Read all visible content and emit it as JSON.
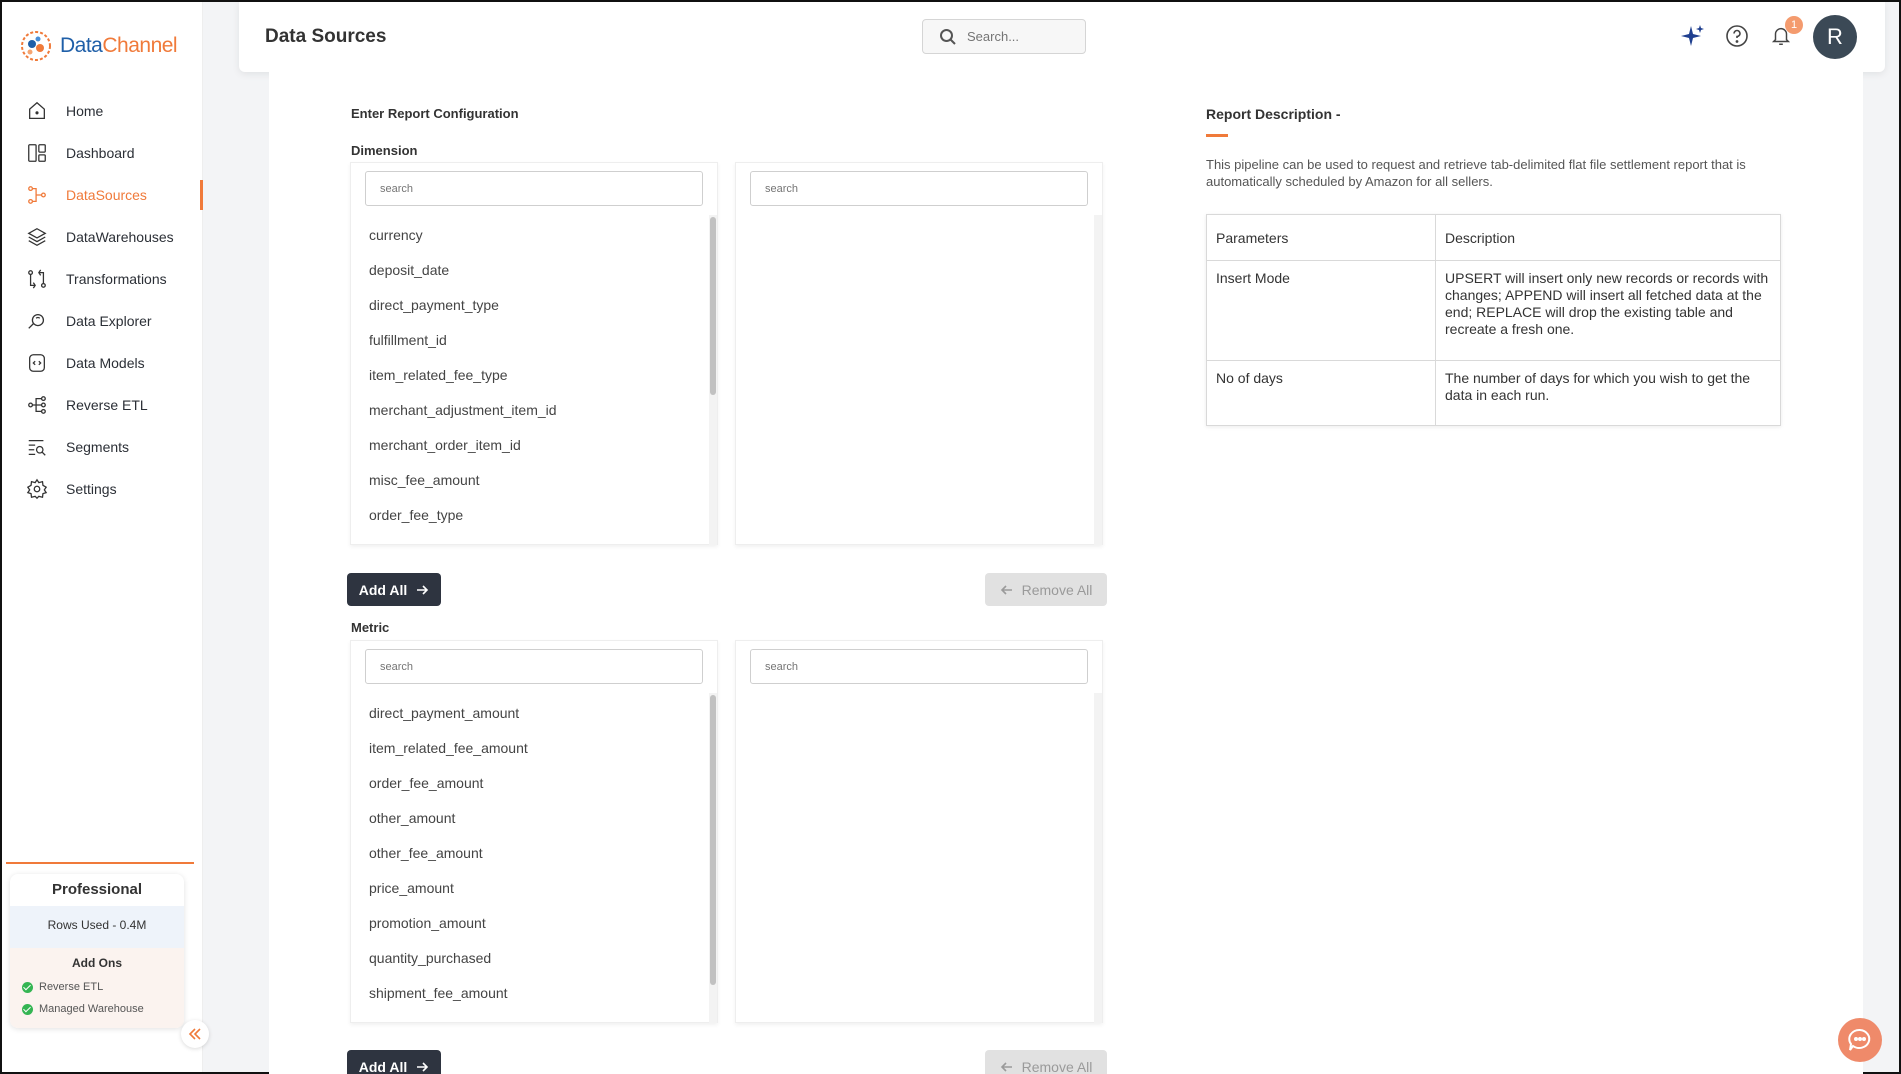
{
  "app": {
    "logo_primary": "Data",
    "logo_secondary": "Channel",
    "brand_color": "#f07a3a"
  },
  "sidebar": {
    "items": [
      {
        "label": "Home",
        "icon": "home-icon"
      },
      {
        "label": "Dashboard",
        "icon": "dashboard-icon"
      },
      {
        "label": "DataSources",
        "icon": "datasources-icon",
        "active": true
      },
      {
        "label": "DataWarehouses",
        "icon": "datawarehouses-icon"
      },
      {
        "label": "Transformations",
        "icon": "transformations-icon"
      },
      {
        "label": "Data Explorer",
        "icon": "data-explorer-icon"
      },
      {
        "label": "Data Models",
        "icon": "data-models-icon"
      },
      {
        "label": "Reverse ETL",
        "icon": "reverse-etl-icon"
      },
      {
        "label": "Segments",
        "icon": "segments-icon"
      },
      {
        "label": "Settings",
        "icon": "settings-icon"
      }
    ],
    "plan": {
      "title": "Professional",
      "rows_used": "Rows Used - 0.4M",
      "addons_title": "Add Ons",
      "addons": [
        "Reverse ETL",
        "Managed Warehouse"
      ]
    }
  },
  "header": {
    "title": "Data Sources",
    "search_placeholder": "Search...",
    "notification_count": "1",
    "avatar_initial": "R"
  },
  "config": {
    "heading": "Enter Report Configuration",
    "dimension": {
      "label": "Dimension",
      "search_placeholder": "search",
      "selected_search_placeholder": "search",
      "available": [
        "currency",
        "deposit_date",
        "direct_payment_type",
        "fulfillment_id",
        "item_related_fee_type",
        "merchant_adjustment_item_id",
        "merchant_order_item_id",
        "misc_fee_amount",
        "order_fee_type"
      ],
      "add_all": "Add All",
      "remove_all": "Remove All"
    },
    "metric": {
      "label": "Metric",
      "search_placeholder": "search",
      "selected_search_placeholder": "search",
      "available": [
        "direct_payment_amount",
        "item_related_fee_amount",
        "order_fee_amount",
        "other_amount",
        "other_fee_amount",
        "price_amount",
        "promotion_amount",
        "quantity_purchased",
        "shipment_fee_amount"
      ],
      "add_all": "Add All",
      "remove_all": "Remove All"
    }
  },
  "description": {
    "title": "Report Description -",
    "text": "This pipeline can be used to request and retrieve tab-delimited flat file settlement report that is automatically scheduled by Amazon for all sellers.",
    "table": {
      "headers": [
        "Parameters",
        "Description"
      ],
      "rows": [
        [
          "Insert Mode",
          "UPSERT will insert only new records or records with changes; APPEND will insert all fetched data at the end; REPLACE will drop the existing table and recreate a fresh one."
        ],
        [
          "No of days",
          "The number of days for which you wish to get the data in each run."
        ]
      ]
    }
  }
}
